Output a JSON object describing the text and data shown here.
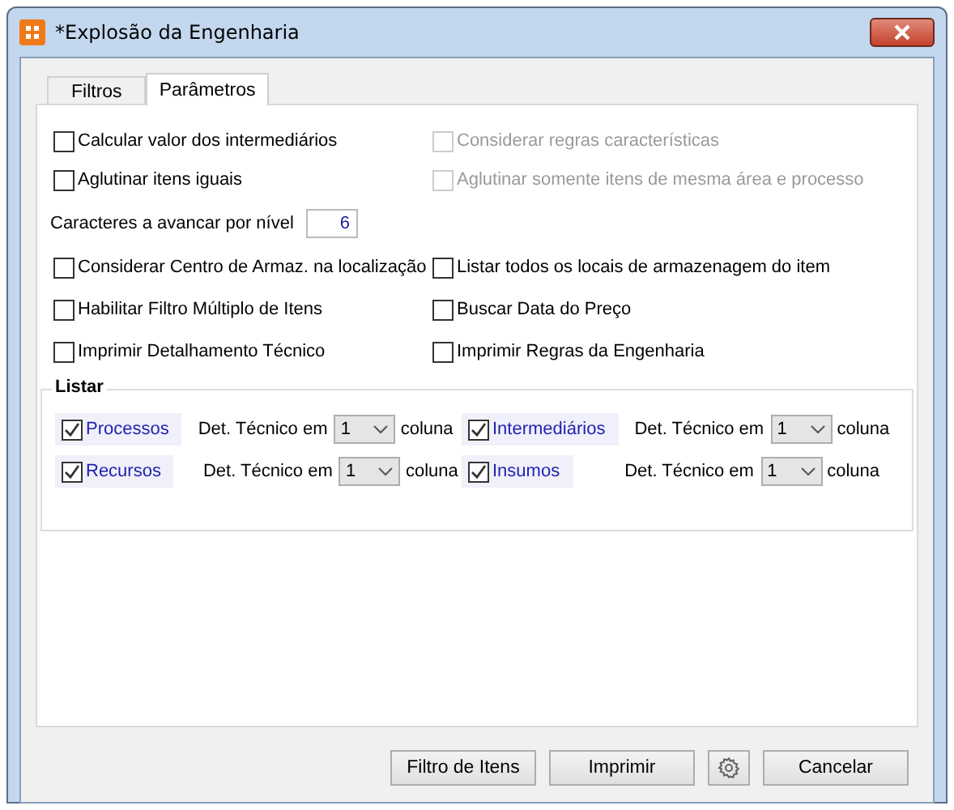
{
  "window": {
    "title": "*Explosão da Engenharia"
  },
  "tabs": [
    {
      "label": "Filtros",
      "selected": false
    },
    {
      "label": "Parâmetros",
      "selected": true
    }
  ],
  "top_options": [
    {
      "label": "Calcular valor dos intermediários",
      "checked": false,
      "disabled": false
    },
    {
      "label": "Considerar regras características",
      "checked": false,
      "disabled": true
    },
    {
      "label": "Aglutinar itens iguais",
      "checked": false,
      "disabled": false
    },
    {
      "label": "Aglutinar somente itens de mesma área e processo",
      "checked": false,
      "disabled": true
    }
  ],
  "level_field": {
    "label": "Caracteres a avancar por nível",
    "value": "6"
  },
  "options": [
    {
      "label": "Considerar Centro de Armaz. na localização",
      "checked": false,
      "disabled": false
    },
    {
      "label": "Listar todos os locais de armazenagem do item",
      "checked": false,
      "disabled": false
    },
    {
      "label": "Habilitar Filtro Múltiplo de Itens",
      "checked": false,
      "disabled": false
    },
    {
      "label": "Buscar Data do Preço",
      "checked": false,
      "disabled": false
    },
    {
      "label": "Imprimir Detalhamento Técnico",
      "checked": false,
      "disabled": false
    },
    {
      "label": "Imprimir Regras da Engenharia",
      "checked": false,
      "disabled": false
    }
  ],
  "listar": {
    "title": "Listar",
    "items": [
      {
        "label": "Processos",
        "checked": true,
        "detail_label": "Det. Técnico em",
        "value": "1",
        "unit": "coluna"
      },
      {
        "label": "Intermediários",
        "checked": true,
        "detail_label": "Det. Técnico em",
        "value": "1",
        "unit": "coluna"
      },
      {
        "label": "Recursos",
        "checked": true,
        "detail_label": "Det. Técnico em",
        "value": "1",
        "unit": "coluna"
      },
      {
        "label": "Insumos",
        "checked": true,
        "detail_label": "Det. Técnico em",
        "value": "1",
        "unit": "coluna"
      }
    ]
  },
  "buttons": [
    {
      "kind": "text",
      "label": "Filtro de Itens"
    },
    {
      "kind": "text",
      "label": "Imprimir"
    },
    {
      "kind": "gear"
    },
    {
      "kind": "text",
      "label": "Cancelar"
    }
  ]
}
